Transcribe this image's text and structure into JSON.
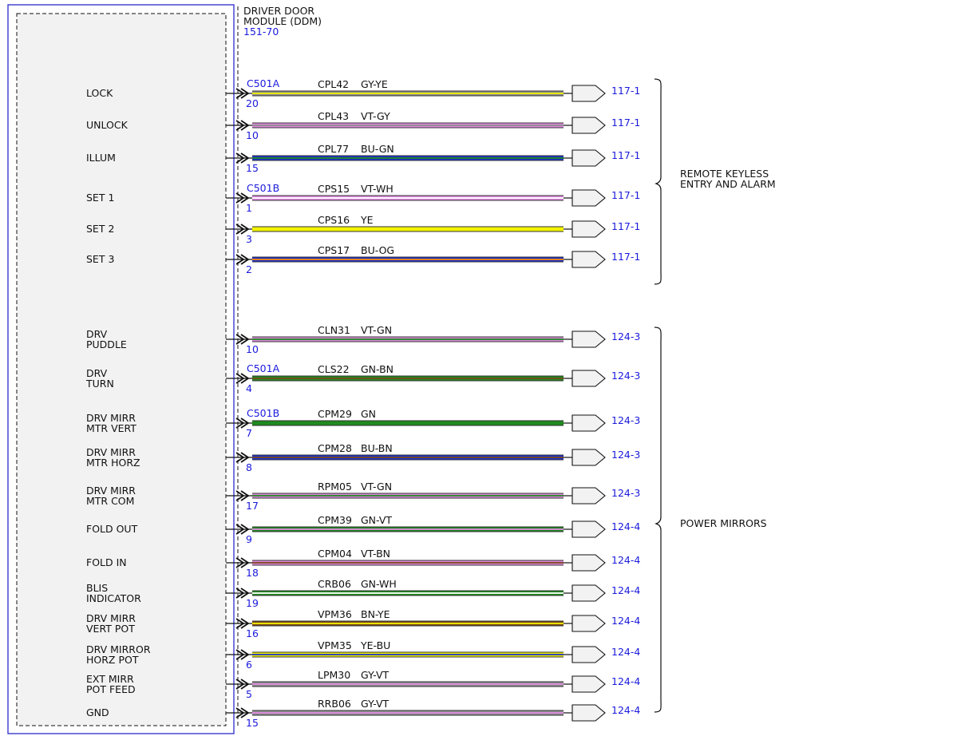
{
  "module": {
    "title_line1": "DRIVER DOOR",
    "title_line2": "MODULE (DDM)",
    "ref": "151-70"
  },
  "colors": {
    "GY": "#8f8f8f",
    "YE": "#f2f200",
    "VT": "#e08ae0",
    "BU": "#1c2fd0",
    "GN": "#1f8a1f",
    "WH": "#ffffff",
    "OG": "#ff8c00",
    "BN": "#7a4a1a",
    "module_border": "#2b2bcc",
    "module_fill": "#f2f2f2",
    "ref_text": "#1a1adc"
  },
  "groups": [
    {
      "label_line1": "REMOTE KEYLESS",
      "label_line2": "ENTRY AND ALARM",
      "first": 0,
      "last": 5
    },
    {
      "label_line1": "POWER MIRRORS",
      "label_line2": "",
      "first": 6,
      "last": 18
    }
  ],
  "circuits": [
    {
      "lines": [
        "LOCK"
      ],
      "connector": "C501A",
      "pin": "20",
      "circuit": "CPL42",
      "color": "GY-YE",
      "base": "GY",
      "stripe": "YE",
      "ref": "117-1"
    },
    {
      "lines": [
        "UNLOCK"
      ],
      "connector": "",
      "pin": "10",
      "circuit": "CPL43",
      "color": "VT-GY",
      "base": "VT",
      "stripe": "GY",
      "ref": "117-1"
    },
    {
      "lines": [
        "ILLUM"
      ],
      "connector": "",
      "pin": "15",
      "circuit": "CPL77",
      "color": "BU-GN",
      "base": "BU",
      "stripe": "GN",
      "ref": "117-1"
    },
    {
      "lines": [
        "SET 1"
      ],
      "connector": "C501B",
      "pin": "1",
      "circuit": "CPS15",
      "color": "VT-WH",
      "base": "VT",
      "stripe": "WH",
      "ref": "117-1"
    },
    {
      "lines": [
        "SET 2"
      ],
      "connector": "",
      "pin": "3",
      "circuit": "CPS16",
      "color": "YE",
      "base": "YE",
      "stripe": "YE",
      "ref": "117-1"
    },
    {
      "lines": [
        "SET 3"
      ],
      "connector": "",
      "pin": "2",
      "circuit": "CPS17",
      "color": "BU-OG",
      "base": "BU",
      "stripe": "OG",
      "ref": "117-1"
    },
    {
      "lines": [
        "DRV",
        "PUDDLE"
      ],
      "connector": "",
      "pin": "10",
      "circuit": "CLN31",
      "color": "VT-GN",
      "base": "VT",
      "stripe": "GN",
      "ref": "124-3"
    },
    {
      "lines": [
        "DRV",
        "TURN"
      ],
      "connector": "C501A",
      "pin": "4",
      "circuit": "CLS22",
      "color": "GN-BN",
      "base": "GN",
      "stripe": "BN",
      "ref": "124-3"
    },
    {
      "lines": [
        "DRV MIRR",
        "MTR VERT"
      ],
      "connector": "C501B",
      "pin": "7",
      "circuit": "CPM29",
      "color": "GN",
      "base": "GN",
      "stripe": "GN",
      "ref": "124-3"
    },
    {
      "lines": [
        "DRV MIRR",
        "MTR HORZ"
      ],
      "connector": "",
      "pin": "8",
      "circuit": "CPM28",
      "color": "BU-BN",
      "base": "BU",
      "stripe": "BN",
      "ref": "124-3"
    },
    {
      "lines": [
        "DRV MIRR",
        "MTR COM"
      ],
      "connector": "",
      "pin": "17",
      "circuit": "RPM05",
      "color": "VT-GN",
      "base": "VT",
      "stripe": "GN",
      "ref": "124-3"
    },
    {
      "lines": [
        "FOLD OUT"
      ],
      "connector": "",
      "pin": "9",
      "circuit": "CPM39",
      "color": "GN-VT",
      "base": "GN",
      "stripe": "VT",
      "ref": "124-4"
    },
    {
      "lines": [
        "FOLD IN"
      ],
      "connector": "",
      "pin": "18",
      "circuit": "CPM04",
      "color": "VT-BN",
      "base": "VT",
      "stripe": "BN",
      "ref": "124-4"
    },
    {
      "lines": [
        "BLIS",
        "INDICATOR"
      ],
      "connector": "",
      "pin": "19",
      "circuit": "CRB06",
      "color": "GN-WH",
      "base": "GN",
      "stripe": "WH",
      "ref": "124-4"
    },
    {
      "lines": [
        "DRV MIRR",
        "VERT POT"
      ],
      "connector": "",
      "pin": "16",
      "circuit": "VPM36",
      "color": "BN-YE",
      "base": "BN",
      "stripe": "YE",
      "ref": "124-4"
    },
    {
      "lines": [
        "DRV MIRROR",
        "HORZ POT"
      ],
      "connector": "",
      "pin": "6",
      "circuit": "VPM35",
      "color": "YE-BU",
      "base": "YE",
      "stripe": "BU",
      "ref": "124-4"
    },
    {
      "lines": [
        "EXT MIRR",
        "POT FEED"
      ],
      "connector": "",
      "pin": "5",
      "circuit": "LPM30",
      "color": "GY-VT",
      "base": "GY",
      "stripe": "VT",
      "ref": "124-4"
    },
    {
      "lines": [
        "GND"
      ],
      "connector": "",
      "pin": "15",
      "circuit": "RRB06",
      "color": "GY-VT",
      "base": "GY",
      "stripe": "VT",
      "ref": "124-4"
    }
  ]
}
